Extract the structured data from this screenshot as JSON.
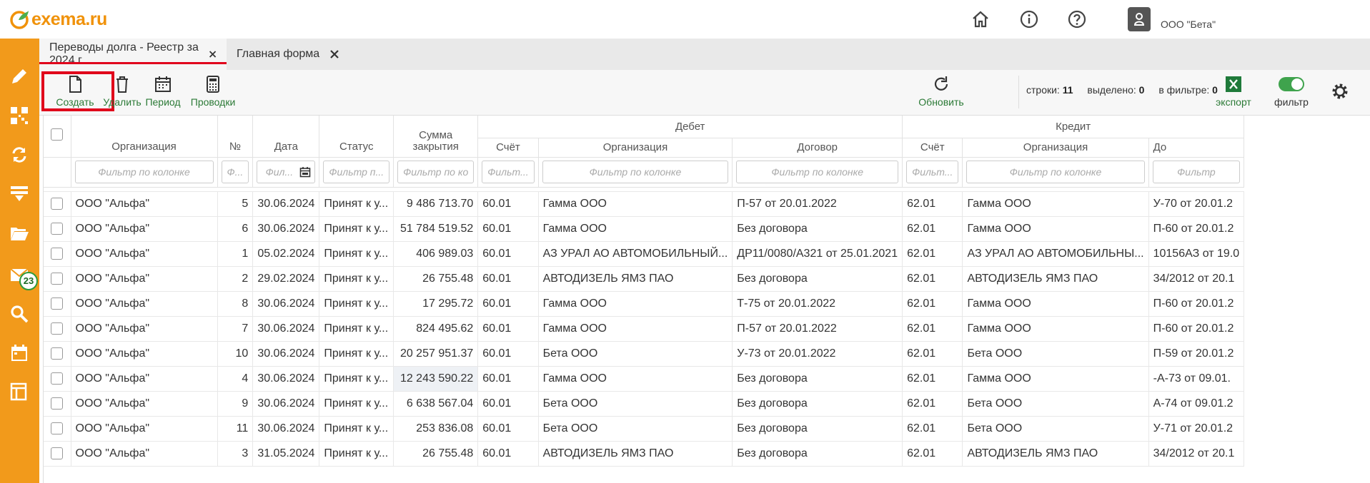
{
  "app": {
    "logo_text": "exema",
    "logo_suffix": ".ru",
    "org_name": "ООО \"Бета\""
  },
  "badges": {
    "mail_count": "23"
  },
  "tabs": [
    {
      "label": "Переводы долга - Реестр за 2024 г."
    },
    {
      "label": "Главная форма"
    }
  ],
  "toolbar": {
    "create": "Создать",
    "delete": "Удалить",
    "period": "Период",
    "postings": "Проводки",
    "refresh": "Обновить",
    "export": "экспорт",
    "filter": "фильтр",
    "rows_label": "строки:",
    "rows_value": "11",
    "selected_label": "выделено:",
    "selected_value": "0",
    "infilter_label": "в фильтре:",
    "infilter_value": "0"
  },
  "grid": {
    "group_debit": "Дебет",
    "group_credit": "Кредит",
    "columns": {
      "org": "Организация",
      "no": "№",
      "date": "Дата",
      "status": "Статус",
      "sum_line1": "Сумма",
      "sum_line2": "закрытия",
      "d_account": "Счёт",
      "d_org": "Организация",
      "d_contract": "Договор",
      "c_account": "Счёт",
      "c_org": "Организация",
      "c_contract": "До"
    },
    "filters": {
      "org": "Фильтр по колонке",
      "no": "Ф...",
      "date": "Фил...",
      "status": "Фильтр п...",
      "sum": "Фильтр по ко",
      "d_account": "Фильт...",
      "d_org": "Фильтр по колонке",
      "d_contract": "Фильтр по колонке",
      "c_account": "Фильт...",
      "c_org": "Фильтр по колонке",
      "c_contract": "Фильтр"
    },
    "rows": [
      {
        "org": "ООО \"Альфа\"",
        "no": "5",
        "date": "30.06.2024",
        "status": "Принят к у...",
        "sum": "9 486 713.70",
        "d_acc": "60.01",
        "d_org": "Гамма ООО",
        "d_con": "П-57 от 20.01.2022",
        "c_acc": "62.01",
        "c_org": "Гамма ООО",
        "c_con": "У-70 от 20.01.2"
      },
      {
        "org": "ООО \"Альфа\"",
        "no": "6",
        "date": "30.06.2024",
        "status": "Принят к у...",
        "sum": "51 784 519.52",
        "d_acc": "60.01",
        "d_org": "Гамма ООО",
        "d_con": "Без договора",
        "c_acc": "62.01",
        "c_org": "Гамма ООО",
        "c_con": "П-60 от 20.01.2"
      },
      {
        "org": "ООО \"Альфа\"",
        "no": "1",
        "date": "05.02.2024",
        "status": "Принят к у...",
        "sum": "406 989.03",
        "d_acc": "60.01",
        "d_org": "АЗ УРАЛ АО АВТОМОБИЛЬНЫЙ...",
        "d_con": "ДР11/0080/А321 от 25.01.2021",
        "c_acc": "62.01",
        "c_org": "АЗ УРАЛ АО АВТОМОБИЛЬНЫ...",
        "c_con": "10156АЗ от 19.0"
      },
      {
        "org": "ООО \"Альфа\"",
        "no": "2",
        "date": "29.02.2024",
        "status": "Принят к у...",
        "sum": "26 755.48",
        "d_acc": "60.01",
        "d_org": "АВТОДИЗЕЛЬ ЯМЗ ПАО",
        "d_con": "Без договора",
        "c_acc": "62.01",
        "c_org": "АВТОДИЗЕЛЬ ЯМЗ ПАО",
        "c_con": "34/2012 от 20.1"
      },
      {
        "org": "ООО \"Альфа\"",
        "no": "8",
        "date": "30.06.2024",
        "status": "Принят к у...",
        "sum": "17 295.72",
        "d_acc": "60.01",
        "d_org": "Гамма ООО",
        "d_con": "Т-75 от 20.01.2022",
        "c_acc": "62.01",
        "c_org": "Гамма ООО",
        "c_con": "П-60 от 20.01.2"
      },
      {
        "org": "ООО \"Альфа\"",
        "no": "7",
        "date": "30.06.2024",
        "status": "Принят к у...",
        "sum": "824 495.62",
        "d_acc": "60.01",
        "d_org": "Гамма ООО",
        "d_con": "П-57 от 20.01.2022",
        "c_acc": "62.01",
        "c_org": "Гамма ООО",
        "c_con": "П-60 от 20.01.2"
      },
      {
        "org": "ООО \"Альфа\"",
        "no": "10",
        "date": "30.06.2024",
        "status": "Принят к у...",
        "sum": "20 257 951.37",
        "d_acc": "60.01",
        "d_org": "Бета ООО",
        "d_con": "У-73 от 20.01.2022",
        "c_acc": "62.01",
        "c_org": "Бета ООО",
        "c_con": "П-59 от 20.01.2"
      },
      {
        "org": "ООО \"Альфа\"",
        "no": "4",
        "date": "30.06.2024",
        "status": "Принят к у...",
        "sum": "12 243 590.22",
        "d_acc": "60.01",
        "d_org": "Гамма ООО",
        "d_con": "Без договора",
        "c_acc": "62.01",
        "c_org": "Гамма ООО",
        "c_con": "-А-73 от 09.01."
      },
      {
        "org": "ООО \"Альфа\"",
        "no": "9",
        "date": "30.06.2024",
        "status": "Принят к у...",
        "sum": "6 638 567.04",
        "d_acc": "60.01",
        "d_org": "Бета ООО",
        "d_con": "Без договора",
        "c_acc": "62.01",
        "c_org": "Бета ООО",
        "c_con": "А-74 от 09.01.2"
      },
      {
        "org": "ООО \"Альфа\"",
        "no": "11",
        "date": "30.06.2024",
        "status": "Принят к у...",
        "sum": "253 836.08",
        "d_acc": "60.01",
        "d_org": "Бета ООО",
        "d_con": "Без договора",
        "c_acc": "62.01",
        "c_org": "Бета ООО",
        "c_con": "У-71 от 20.01.2"
      },
      {
        "org": "ООО \"Альфа\"",
        "no": "3",
        "date": "31.05.2024",
        "status": "Принят к у...",
        "sum": "26 755.48",
        "d_acc": "60.01",
        "d_org": "АВТОДИЗЕЛЬ ЯМЗ ПАО",
        "d_con": "Без договора",
        "c_acc": "62.01",
        "c_org": "АВТОДИЗЕЛЬ ЯМЗ ПАО",
        "c_con": "34/2012 от 20.1"
      }
    ]
  }
}
